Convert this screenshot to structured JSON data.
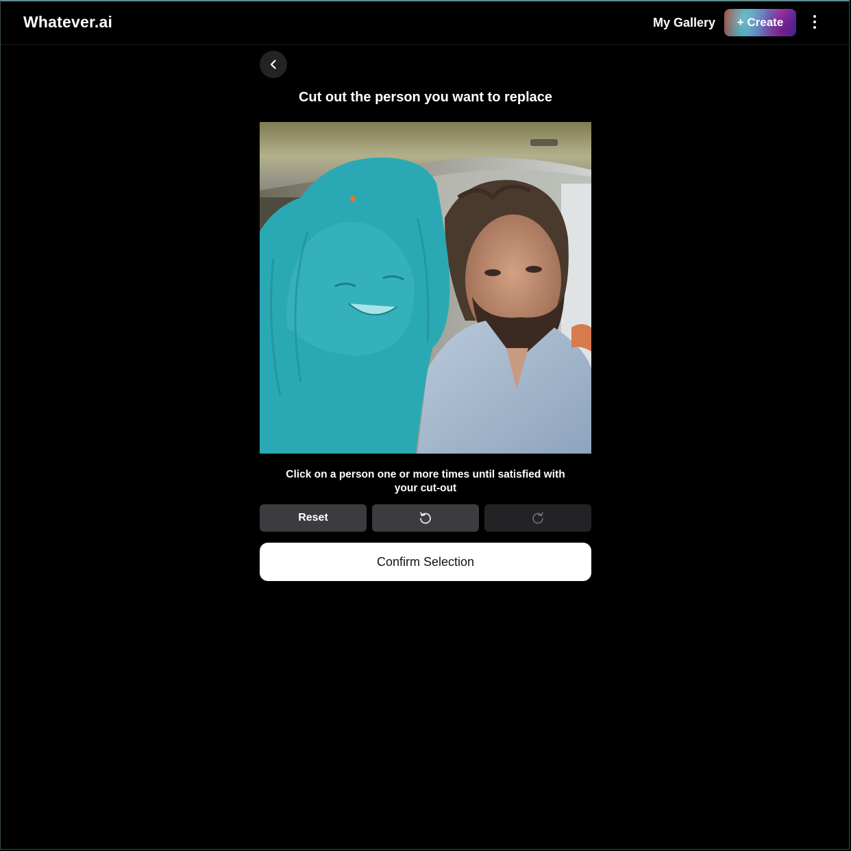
{
  "header": {
    "logo": "Whatever.ai",
    "gallery_label": "My Gallery",
    "create_label": "+ Create"
  },
  "main": {
    "title": "Cut out the person you want to replace",
    "photo_alt": "Selfie of two people on an airplane, left person highlighted",
    "hint": "Click on a person one or more times until satisfied with your cut-out",
    "controls": {
      "reset_label": "Reset"
    },
    "confirm_label": "Confirm Selection"
  },
  "icons": {
    "back": "chevron-left-icon",
    "menu": "more-vertical-icon",
    "undo": "undo-icon",
    "redo": "redo-icon"
  },
  "colors": {
    "background": "#000000",
    "selection_mask": "#2aa9b4",
    "click_marker": "#e0782c",
    "button_active": "#3c3c40",
    "button_disabled": "#232325",
    "confirm_bg": "#ffffff"
  }
}
